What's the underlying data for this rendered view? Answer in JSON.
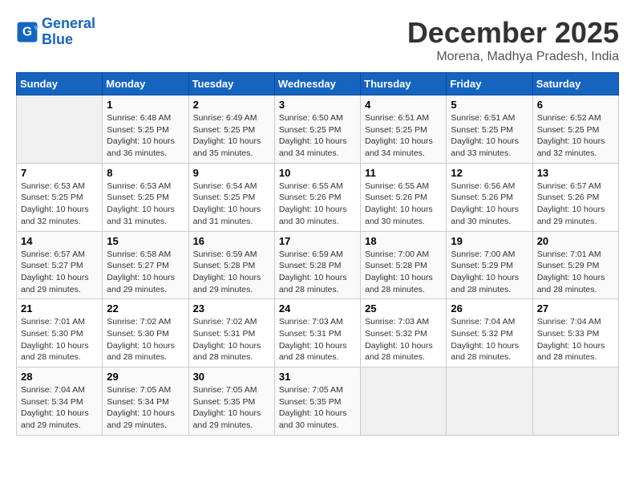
{
  "logo": {
    "line1": "General",
    "line2": "Blue"
  },
  "title": "December 2025",
  "subtitle": "Morena, Madhya Pradesh, India",
  "days_header": [
    "Sunday",
    "Monday",
    "Tuesday",
    "Wednesday",
    "Thursday",
    "Friday",
    "Saturday"
  ],
  "weeks": [
    [
      {
        "day": "",
        "info": ""
      },
      {
        "day": "1",
        "info": "Sunrise: 6:48 AM\nSunset: 5:25 PM\nDaylight: 10 hours\nand 36 minutes."
      },
      {
        "day": "2",
        "info": "Sunrise: 6:49 AM\nSunset: 5:25 PM\nDaylight: 10 hours\nand 35 minutes."
      },
      {
        "day": "3",
        "info": "Sunrise: 6:50 AM\nSunset: 5:25 PM\nDaylight: 10 hours\nand 34 minutes."
      },
      {
        "day": "4",
        "info": "Sunrise: 6:51 AM\nSunset: 5:25 PM\nDaylight: 10 hours\nand 34 minutes."
      },
      {
        "day": "5",
        "info": "Sunrise: 6:51 AM\nSunset: 5:25 PM\nDaylight: 10 hours\nand 33 minutes."
      },
      {
        "day": "6",
        "info": "Sunrise: 6:52 AM\nSunset: 5:25 PM\nDaylight: 10 hours\nand 32 minutes."
      }
    ],
    [
      {
        "day": "7",
        "info": "Sunrise: 6:53 AM\nSunset: 5:25 PM\nDaylight: 10 hours\nand 32 minutes."
      },
      {
        "day": "8",
        "info": "Sunrise: 6:53 AM\nSunset: 5:25 PM\nDaylight: 10 hours\nand 31 minutes."
      },
      {
        "day": "9",
        "info": "Sunrise: 6:54 AM\nSunset: 5:25 PM\nDaylight: 10 hours\nand 31 minutes."
      },
      {
        "day": "10",
        "info": "Sunrise: 6:55 AM\nSunset: 5:26 PM\nDaylight: 10 hours\nand 30 minutes."
      },
      {
        "day": "11",
        "info": "Sunrise: 6:55 AM\nSunset: 5:26 PM\nDaylight: 10 hours\nand 30 minutes."
      },
      {
        "day": "12",
        "info": "Sunrise: 6:56 AM\nSunset: 5:26 PM\nDaylight: 10 hours\nand 30 minutes."
      },
      {
        "day": "13",
        "info": "Sunrise: 6:57 AM\nSunset: 5:26 PM\nDaylight: 10 hours\nand 29 minutes."
      }
    ],
    [
      {
        "day": "14",
        "info": "Sunrise: 6:57 AM\nSunset: 5:27 PM\nDaylight: 10 hours\nand 29 minutes."
      },
      {
        "day": "15",
        "info": "Sunrise: 6:58 AM\nSunset: 5:27 PM\nDaylight: 10 hours\nand 29 minutes."
      },
      {
        "day": "16",
        "info": "Sunrise: 6:59 AM\nSunset: 5:28 PM\nDaylight: 10 hours\nand 29 minutes."
      },
      {
        "day": "17",
        "info": "Sunrise: 6:59 AM\nSunset: 5:28 PM\nDaylight: 10 hours\nand 28 minutes."
      },
      {
        "day": "18",
        "info": "Sunrise: 7:00 AM\nSunset: 5:28 PM\nDaylight: 10 hours\nand 28 minutes."
      },
      {
        "day": "19",
        "info": "Sunrise: 7:00 AM\nSunset: 5:29 PM\nDaylight: 10 hours\nand 28 minutes."
      },
      {
        "day": "20",
        "info": "Sunrise: 7:01 AM\nSunset: 5:29 PM\nDaylight: 10 hours\nand 28 minutes."
      }
    ],
    [
      {
        "day": "21",
        "info": "Sunrise: 7:01 AM\nSunset: 5:30 PM\nDaylight: 10 hours\nand 28 minutes."
      },
      {
        "day": "22",
        "info": "Sunrise: 7:02 AM\nSunset: 5:30 PM\nDaylight: 10 hours\nand 28 minutes."
      },
      {
        "day": "23",
        "info": "Sunrise: 7:02 AM\nSunset: 5:31 PM\nDaylight: 10 hours\nand 28 minutes."
      },
      {
        "day": "24",
        "info": "Sunrise: 7:03 AM\nSunset: 5:31 PM\nDaylight: 10 hours\nand 28 minutes."
      },
      {
        "day": "25",
        "info": "Sunrise: 7:03 AM\nSunset: 5:32 PM\nDaylight: 10 hours\nand 28 minutes."
      },
      {
        "day": "26",
        "info": "Sunrise: 7:04 AM\nSunset: 5:32 PM\nDaylight: 10 hours\nand 28 minutes."
      },
      {
        "day": "27",
        "info": "Sunrise: 7:04 AM\nSunset: 5:33 PM\nDaylight: 10 hours\nand 28 minutes."
      }
    ],
    [
      {
        "day": "28",
        "info": "Sunrise: 7:04 AM\nSunset: 5:34 PM\nDaylight: 10 hours\nand 29 minutes."
      },
      {
        "day": "29",
        "info": "Sunrise: 7:05 AM\nSunset: 5:34 PM\nDaylight: 10 hours\nand 29 minutes."
      },
      {
        "day": "30",
        "info": "Sunrise: 7:05 AM\nSunset: 5:35 PM\nDaylight: 10 hours\nand 29 minutes."
      },
      {
        "day": "31",
        "info": "Sunrise: 7:05 AM\nSunset: 5:35 PM\nDaylight: 10 hours\nand 30 minutes."
      },
      {
        "day": "",
        "info": ""
      },
      {
        "day": "",
        "info": ""
      },
      {
        "day": "",
        "info": ""
      }
    ]
  ]
}
